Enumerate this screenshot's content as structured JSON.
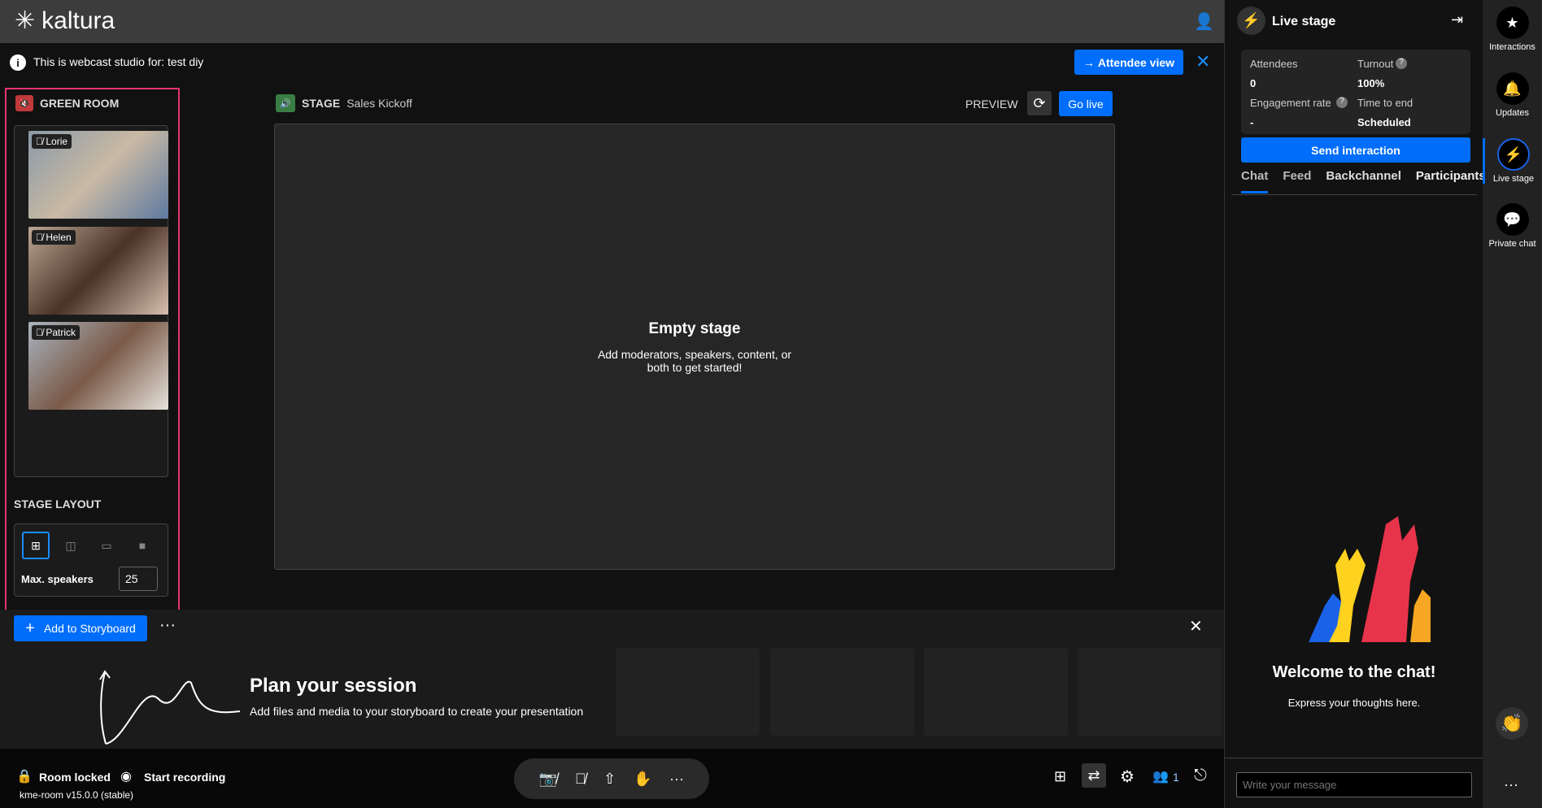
{
  "header": {
    "logo": "kaltura"
  },
  "info": {
    "text": "This is webcast studio for: test diy",
    "attendee_view": "Attendee view"
  },
  "green_room": {
    "title": "GREEN ROOM",
    "participants": [
      {
        "name": "Lorie"
      },
      {
        "name": "Helen"
      },
      {
        "name": "Patrick"
      }
    ]
  },
  "stage_layout": {
    "title": "STAGE LAYOUT",
    "max_speakers_label": "Max. speakers",
    "max_speakers": "25"
  },
  "stage": {
    "label": "STAGE",
    "name": "Sales Kickoff",
    "preview": "PREVIEW",
    "go_live": "Go live",
    "empty_title": "Empty stage",
    "empty_line1": "Add moderators, speakers, content, or",
    "empty_line2": "both to get started!"
  },
  "storyboard": {
    "add": "Add to Storyboard",
    "plan_title": "Plan your session",
    "plan_sub": "Add files and media to your storyboard to create your presentation"
  },
  "bottom": {
    "room_locked": "Room locked",
    "start_recording": "Start recording",
    "version": "kme-room v15.0.0 (stable)",
    "participants_count": "1"
  },
  "live_panel": {
    "title": "Live stage",
    "attendees_label": "Attendees",
    "attendees": "0",
    "turnout_label": "Turnout",
    "turnout": "100%",
    "engagement_label": "Engagement rate",
    "engagement": "-",
    "time_label": "Time to end",
    "time": "Scheduled",
    "send": "Send interaction",
    "tabs": [
      "Chat",
      "Feed",
      "Backchannel",
      "Participants"
    ],
    "welcome": "Welcome to the chat!",
    "express": "Express your thoughts here.",
    "placeholder": "Write your message"
  },
  "rail": {
    "items": [
      "Interactions",
      "Updates",
      "Live stage",
      "Private chat"
    ]
  },
  "colors": {
    "accent": "#006efa",
    "highlight": "#e8336f",
    "muted": "#c0393b",
    "live": "#3a7d44"
  }
}
